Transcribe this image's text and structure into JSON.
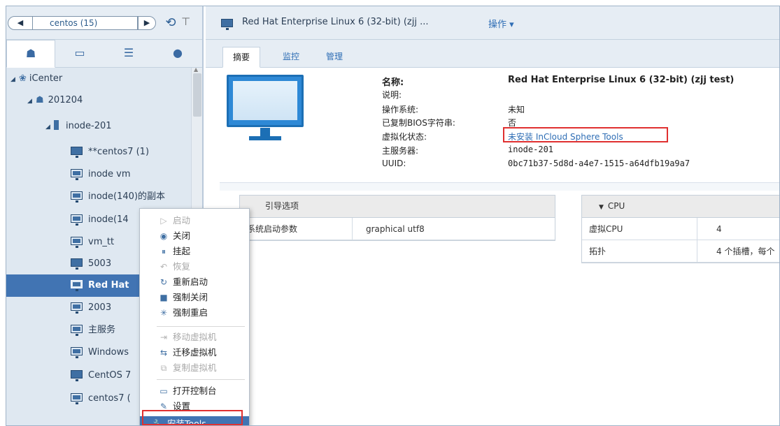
{
  "nav": {
    "back": "◀",
    "combo": "centos (15)",
    "forward": "▶"
  },
  "left_tabs": [
    "hosts-and-clusters",
    "vms-and-templates",
    "storage",
    "networking"
  ],
  "tree": {
    "root": "iCenter",
    "datacenter": "201204",
    "host": "inode-201",
    "vms": [
      "**centos7 (1)",
      "inode vm",
      "inode(140)的副本",
      "inode(14",
      "vm_tt",
      "5003",
      "Red Hat",
      "2003",
      "主服务",
      "Windows",
      "CentOS 7",
      "centos7 ("
    ],
    "selected_index": 6
  },
  "title_bar": {
    "vm_name": "Red Hat Enterprise Linux 6 (32-bit) (zjj ...",
    "actions": "操作 ▾"
  },
  "tabs": [
    "摘要",
    "监控",
    "管理"
  ],
  "active_tab": "摘要",
  "summary": {
    "labels": [
      "名称:",
      "说明:",
      "操作系统:",
      "已复制BIOS字符串:",
      "虚拟化状态:",
      "主服务器:",
      "UUID:"
    ],
    "name": "Red Hat Enterprise Linux 6 (32-bit) (zjj test)",
    "description": "",
    "os": "未知",
    "bios_copied": "否",
    "virt_status": "未安装 InCloud Sphere Tools",
    "host": "inode-201",
    "uuid": "0bc71b37-5d8d-a4e7-1515-a64dfb19a9a7"
  },
  "boot_panel": {
    "header": "引导选项",
    "row_label": "系统启动参数",
    "row_value": "graphical utf8"
  },
  "cpu_panel": {
    "header": "CPU",
    "rows": [
      {
        "label": "虚拟CPU",
        "value": "4"
      },
      {
        "label": "拓扑",
        "value": "4 个插槽，每个"
      }
    ]
  },
  "context_menu": {
    "items": [
      {
        "label": "启动",
        "enabled": false,
        "icon": "play-circle-icon"
      },
      {
        "label": "关闭",
        "enabled": true,
        "icon": "stop-circle-icon"
      },
      {
        "label": "挂起",
        "enabled": true,
        "icon": "pause-circle-icon"
      },
      {
        "label": "恢复",
        "enabled": false,
        "icon": "resume-icon"
      },
      {
        "label": "重新启动",
        "enabled": true,
        "icon": "restart-icon"
      },
      {
        "label": "强制关闭",
        "enabled": true,
        "icon": "force-stop-icon"
      },
      {
        "label": "强制重启",
        "enabled": true,
        "icon": "force-restart-icon"
      },
      {
        "label": "移动虚拟机",
        "enabled": false,
        "icon": "move-vm-icon"
      },
      {
        "label": "迁移虚拟机",
        "enabled": true,
        "icon": "migrate-vm-icon"
      },
      {
        "label": "复制虚拟机",
        "enabled": false,
        "icon": "copy-vm-icon"
      },
      {
        "label": "打开控制台",
        "enabled": true,
        "icon": "console-icon"
      },
      {
        "label": "设置",
        "enabled": true,
        "icon": "settings-icon"
      },
      {
        "label": "安装Tools",
        "enabled": true,
        "icon": "wrench-icon",
        "highlighted": true
      }
    ]
  },
  "colors": {
    "selection": "#4174b3",
    "link": "#2f6eb5",
    "annotation": "#e03030"
  }
}
